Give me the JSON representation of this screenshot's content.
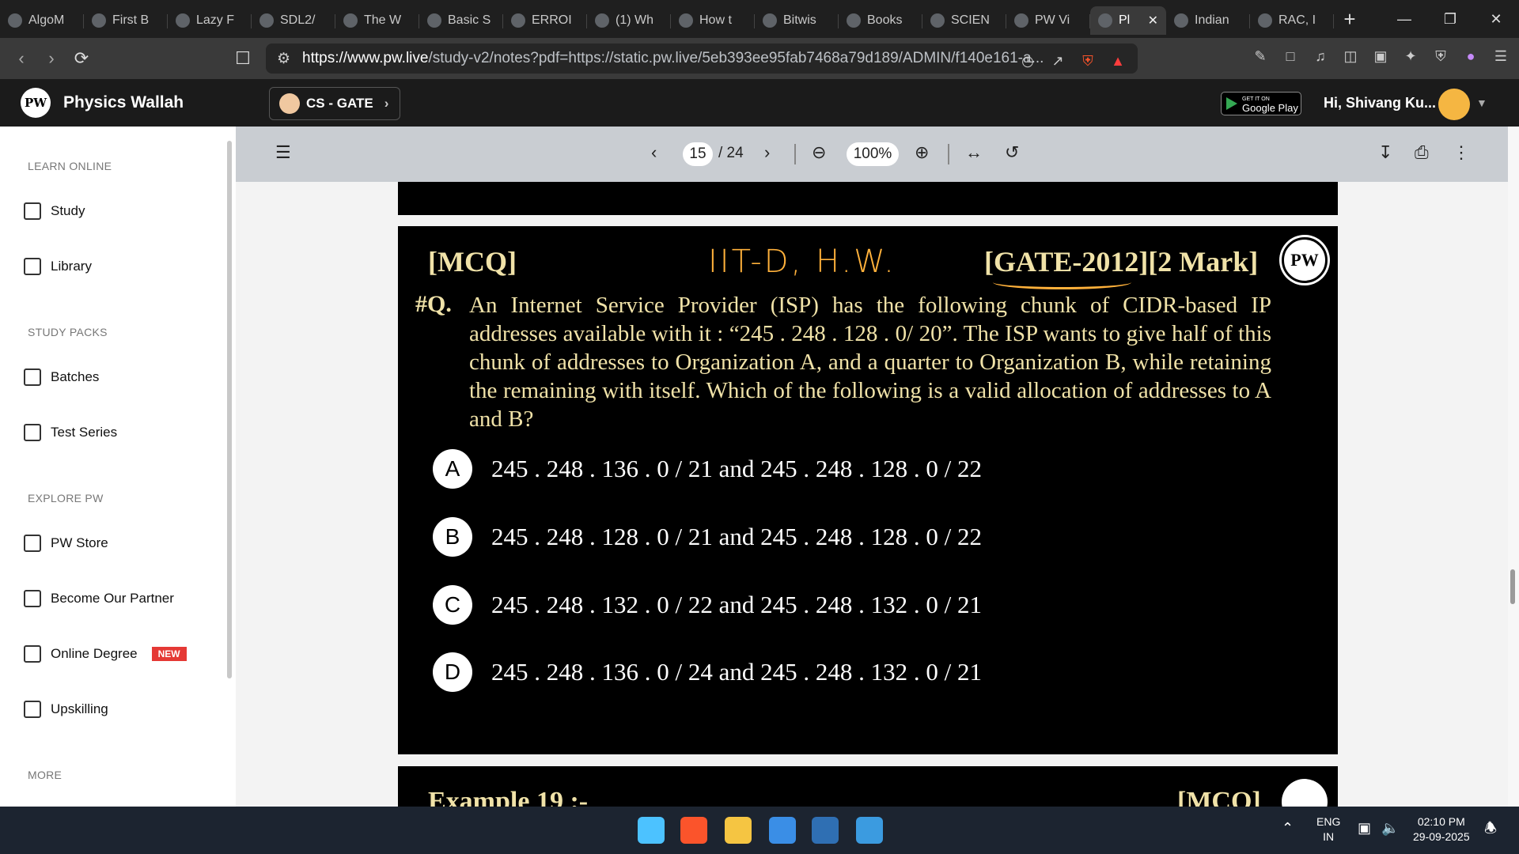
{
  "browser": {
    "tabs": [
      {
        "title": "AlgoM",
        "active": false
      },
      {
        "title": "First B",
        "active": false
      },
      {
        "title": "Lazy F",
        "active": false
      },
      {
        "title": "SDL2/",
        "active": false
      },
      {
        "title": "The W",
        "active": false
      },
      {
        "title": "Basic S",
        "active": false
      },
      {
        "title": "ERROI",
        "active": false
      },
      {
        "title": "(1) Wh",
        "active": false
      },
      {
        "title": "How t",
        "active": false
      },
      {
        "title": "Bitwis",
        "active": false
      },
      {
        "title": "Books",
        "active": false
      },
      {
        "title": "SCIEN",
        "active": false
      },
      {
        "title": "PW Vi",
        "active": false
      },
      {
        "title": "Pl",
        "active": true
      },
      {
        "title": "Indian",
        "active": false
      },
      {
        "title": "RAC, I",
        "active": false
      }
    ],
    "url_domain": "https://www.pw.live",
    "url_rest": "/study-v2/notes?pdf=https://static.pw.live/5eb393ee95fab7468a79d189/ADMIN/f140e161-a...",
    "shield_count": "5"
  },
  "site": {
    "name": "Physics Wallah",
    "logo_text": "PW",
    "batch": "CS - GATE",
    "gplay_small": "GET IT ON",
    "gplay_big": "Google Play",
    "greeting": "Hi, Shivang Ku..."
  },
  "sidebar": {
    "sections": [
      {
        "title": "LEARN ONLINE",
        "items": [
          "Study",
          "Library"
        ]
      },
      {
        "title": "STUDY PACKS",
        "items": [
          "Batches",
          "Test Series"
        ]
      },
      {
        "title": "EXPLORE PW",
        "items": [
          "PW Store",
          "Become Our Partner",
          "Online Degree",
          "Upskilling"
        ]
      },
      {
        "title": "MORE",
        "items": []
      }
    ],
    "new_badge": "NEW"
  },
  "pdf": {
    "page": "15",
    "total": "/ 24",
    "zoom": "100%"
  },
  "slide": {
    "tag": "[MCQ]",
    "handwritten": "IIT-D, H.W.",
    "exam": "[GATE-2012][2 Mark]",
    "qnum": "#Q.",
    "question": "An Internet Service Provider (ISP) has the following chunk of CIDR-based IP addresses available with it : “245 . 248 . 128 . 0/ 20”. The ISP wants to give half of this chunk of addresses to Organization A, and a quarter to Organization B, while retaining the remaining with itself. Which of the following is a valid allocation of addresses to A and B?",
    "options": [
      {
        "letter": "A",
        "text": "245 . 248 . 136 . 0 / 21 and 245 . 248 . 128 . 0 / 22"
      },
      {
        "letter": "B",
        "text": "245 . 248 . 128 . 0 / 21 and 245 . 248 . 128 . 0 / 22"
      },
      {
        "letter": "C",
        "text": "245 . 248 . 132 . 0 / 22 and 245 . 248 . 132 . 0 / 21"
      },
      {
        "letter": "D",
        "text": "245 . 248 . 136 . 0 / 24 and 245 . 248 . 132 . 0 / 21"
      }
    ],
    "next_title": "Example 19 :-",
    "next_tag": "[MCQ]"
  },
  "taskbar": {
    "lang1": "ENG",
    "lang2": "IN",
    "time": "02:10 PM",
    "date": "29-09-2025"
  }
}
